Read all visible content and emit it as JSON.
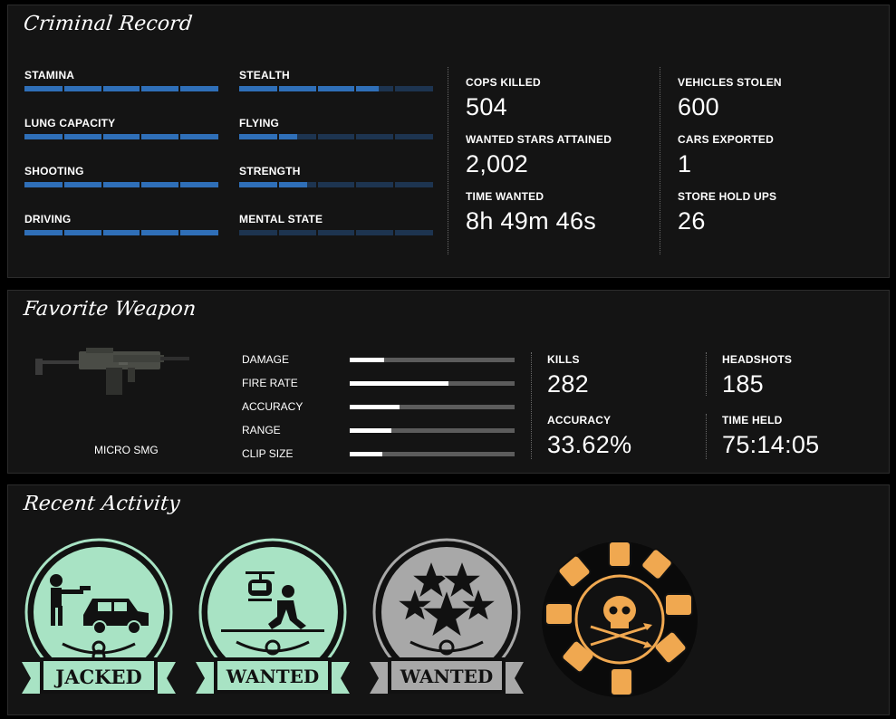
{
  "criminal_record": {
    "title": "Criminal Record",
    "skills": [
      {
        "label": "STAMINA",
        "value": 1.0
      },
      {
        "label": "LUNG CAPACITY",
        "value": 1.0
      },
      {
        "label": "SHOOTING",
        "value": 1.0
      },
      {
        "label": "DRIVING",
        "value": 1.0
      },
      {
        "label": "STEALTH",
        "value": 0.72
      },
      {
        "label": "FLYING",
        "value": 0.3
      },
      {
        "label": "STRENGTH",
        "value": 0.35
      },
      {
        "label": "MENTAL STATE",
        "value": 0.0
      }
    ],
    "stats": [
      {
        "label": "COPS KILLED",
        "value": "504"
      },
      {
        "label": "WANTED STARS ATTAINED",
        "value": "2,002"
      },
      {
        "label": "TIME WANTED",
        "value": "8h 49m 46s"
      },
      {
        "label": "VEHICLES STOLEN",
        "value": "600"
      },
      {
        "label": "CARS EXPORTED",
        "value": "1"
      },
      {
        "label": "STORE HOLD UPS",
        "value": "26"
      }
    ]
  },
  "favorite_weapon": {
    "title": "Favorite Weapon",
    "name": "MICRO SMG",
    "attributes": [
      {
        "label": "DAMAGE",
        "value": 0.21
      },
      {
        "label": "FIRE RATE",
        "value": 0.6
      },
      {
        "label": "ACCURACY",
        "value": 0.3
      },
      {
        "label": "RANGE",
        "value": 0.25
      },
      {
        "label": "CLIP SIZE",
        "value": 0.2
      }
    ],
    "stats": [
      {
        "label": "KILLS",
        "value": "282"
      },
      {
        "label": "ACCURACY",
        "value": "33.62%"
      },
      {
        "label": "HEADSHOTS",
        "value": "185"
      },
      {
        "label": "TIME HELD",
        "value": "75:14:05"
      }
    ]
  },
  "recent_activity": {
    "title": "Recent Activity",
    "badges": [
      {
        "label": "JACKED",
        "color": "#a8e3c4",
        "icon": "carjacking-icon"
      },
      {
        "label": "WANTED",
        "color": "#a8e3c4",
        "icon": "helicopter-chase-icon"
      },
      {
        "label": "WANTED",
        "color": "#a8a8a8",
        "icon": "stars-icon"
      },
      {
        "label": "",
        "color": "#f0a850",
        "icon": "skull-fists-icon"
      }
    ]
  }
}
